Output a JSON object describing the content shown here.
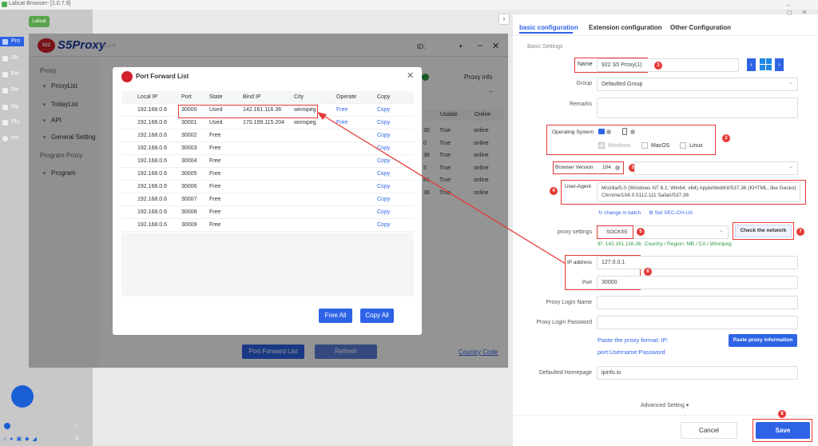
{
  "app": {
    "title": "Lalicat Browser- [1.0.7.9]"
  },
  "sidebar": {
    "brand": "Lalicat",
    "items": [
      "Pro",
      "Sh",
      "Fol",
      "Re",
      "My",
      "Plu",
      "Ins"
    ]
  },
  "s5": {
    "logo_text": "S5Proxy",
    "logo_badge": "922",
    "version": "V1.2.0",
    "id_label": "ID:",
    "proxy_info": "Proxy info",
    "proxy_info_sub": "--",
    "menu": {
      "proxy_head": "Proxy",
      "proxy_items": [
        "ProxyList",
        "TodayList",
        "API",
        "General Setting"
      ],
      "program_head": "Program Proxy",
      "program_items": [
        "Program"
      ]
    },
    "bg_table": {
      "headers": [
        "Usable",
        "Online"
      ],
      "rows": [
        [
          "30",
          "True",
          "online"
        ],
        [
          "0",
          "True",
          "online"
        ],
        [
          "38",
          "True",
          "online"
        ],
        [
          "5",
          "True",
          "online"
        ],
        [
          "81",
          "True",
          "online"
        ],
        [
          "38",
          "True",
          "online"
        ]
      ]
    },
    "bottom": {
      "port_forward_btn": "Port Forward List",
      "refresh_btn": "Refresh",
      "country_code": "Country Code"
    }
  },
  "modal": {
    "title": "Port Forward List",
    "headers": [
      "Local IP",
      "Port",
      "State",
      "Bind IP",
      "City",
      "Operate",
      "Copy"
    ],
    "rows": [
      {
        "ip": "192.168.0.6",
        "port": "30000",
        "state": "Used",
        "bind": "142.161.116.36",
        "city": "winnipeg",
        "op": "Free",
        "copy": "Copy"
      },
      {
        "ip": "192.168.0.6",
        "port": "30001",
        "state": "Used",
        "bind": "170.199.115.204",
        "city": "winnipeg",
        "op": "Free",
        "copy": "Copy"
      },
      {
        "ip": "192.168.0.6",
        "port": "30002",
        "state": "Free",
        "bind": "",
        "city": "",
        "op": "",
        "copy": "Copy"
      },
      {
        "ip": "192.168.0.6",
        "port": "30003",
        "state": "Free",
        "bind": "",
        "city": "",
        "op": "",
        "copy": "Copy"
      },
      {
        "ip": "192.168.0.6",
        "port": "30004",
        "state": "Free",
        "bind": "",
        "city": "",
        "op": "",
        "copy": "Copy"
      },
      {
        "ip": "192.168.0.6",
        "port": "30005",
        "state": "Free",
        "bind": "",
        "city": "",
        "op": "",
        "copy": "Copy"
      },
      {
        "ip": "192.168.0.6",
        "port": "30006",
        "state": "Free",
        "bind": "",
        "city": "",
        "op": "",
        "copy": "Copy"
      },
      {
        "ip": "192.168.0.6",
        "port": "30007",
        "state": "Free",
        "bind": "",
        "city": "",
        "op": "",
        "copy": "Copy"
      },
      {
        "ip": "192.168.0.6",
        "port": "30008",
        "state": "Free",
        "bind": "",
        "city": "",
        "op": "",
        "copy": "Copy"
      },
      {
        "ip": "192.168.0.6",
        "port": "30009",
        "state": "Free",
        "bind": "",
        "city": "",
        "op": "",
        "copy": "Copy"
      }
    ],
    "free_all": "Free All",
    "copy_all": "Copy All"
  },
  "panel": {
    "tabs": [
      "basic configuration",
      "Extension configuration",
      "Other Configuration"
    ],
    "section": "Basic Settings",
    "name_label": "Name",
    "name_value": "922 S5 Proxy(1)",
    "group_label": "Group",
    "group_value": "Defaulted Group",
    "remarks_label": "Remarks",
    "os_label": "Operating System",
    "os_options": [
      "Windows",
      "MacOS",
      "Linux"
    ],
    "browser_version_label": "Browser Version",
    "browser_version_value": "104",
    "ua_label": "User-Agent",
    "ua_value": "Mozilla/5.0 (Windows NT 6.1; Win64; x64) AppleWebKit/537.36 (KHTML, like Gecko) Chrome/104.0.5112.111 Safari/537.36",
    "change_batch": "change in batch",
    "set_sec": "Set SEC-CH-UA",
    "proxy_settings_label": "proxy settings",
    "proxy_settings_value": "SOCKS5",
    "check_network": "Check the network",
    "ip_info": "IP: 142.161.116.36",
    "region_info": "Country / Region: MB / CA / Winnipeg",
    "ip_address_label": "IP address",
    "ip_address_value": "127.0.0.1",
    "port_label": "Port",
    "port_value": "30000",
    "login_name_label": "Proxy Login Name",
    "login_pwd_label": "Proxy Login Password",
    "paste_hint_1": "Paste the proxy format: IP:",
    "paste_hint_2": "port:Username:Password",
    "paste_btn": "Paste proxy information",
    "homepage_label": "Defaulted Homepage",
    "homepage_value": "ipinfo.io",
    "advanced": "Advanced Setting",
    "cancel": "Cancel",
    "save": "Save"
  },
  "badges": [
    "1",
    "2",
    "3",
    "4",
    "5",
    "6",
    "7",
    "8"
  ],
  "colors": {
    "accent": "#2e63e6",
    "annotation": "#e53935",
    "success": "#2e9a45"
  }
}
